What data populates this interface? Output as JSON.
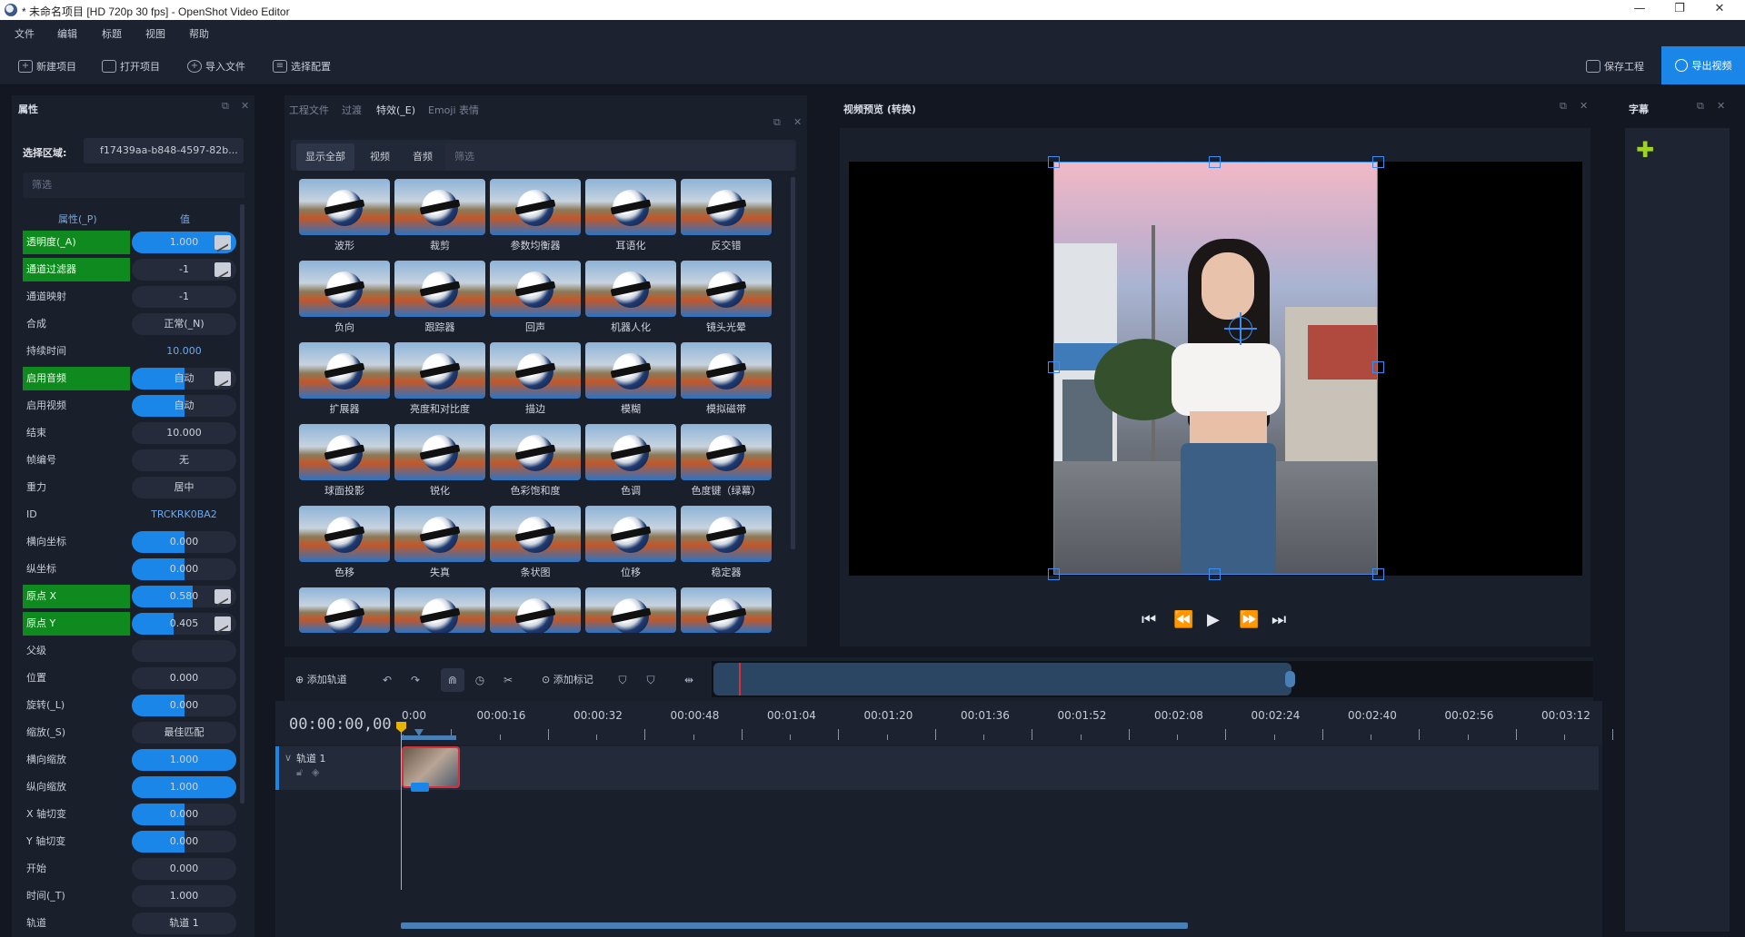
{
  "window": {
    "title": "* 未命名项目 [HD 720p 30 fps] - OpenShot Video Editor",
    "min": "—",
    "max": "❐",
    "close": "✕"
  },
  "menu": [
    "文件",
    "编辑",
    "标题",
    "视图",
    "帮助"
  ],
  "toolbar": {
    "new_project": "新建项目",
    "open_project": "打开项目",
    "import_files": "导入文件",
    "profile": "选择配置",
    "save": "保存工程",
    "export": "导出视频"
  },
  "properties": {
    "title": "属性",
    "selection_label": "选择区域:",
    "selection_value": "f17439aa-b848-4597-82b...",
    "filter_placeholder": "筛选",
    "col_property": "属性(_P)",
    "col_value": "值",
    "rows": [
      {
        "label": "透明度(_A)",
        "value": "1.000",
        "green": true,
        "fill": 1.0,
        "kf": true
      },
      {
        "label": "通道过滤器",
        "value": "-1",
        "green": true,
        "fill": 0,
        "kf": true
      },
      {
        "label": "通道映射",
        "value": "-1",
        "green": false,
        "fill": 0,
        "kf": false
      },
      {
        "label": "合成",
        "value": "正常(_N)",
        "green": false,
        "fill": 0,
        "kf": false
      },
      {
        "label": "持续时间",
        "value": "10.000",
        "green": false,
        "fill": -1,
        "kf": false
      },
      {
        "label": "启用音频",
        "value": "自动",
        "green": true,
        "fill": 0.5,
        "kf": true
      },
      {
        "label": "启用视频",
        "value": "自动",
        "green": false,
        "fill": 0.5,
        "kf": false
      },
      {
        "label": "结束",
        "value": "10.000",
        "green": false,
        "fill": 0,
        "kf": false
      },
      {
        "label": "帧编号",
        "value": "无",
        "green": false,
        "fill": 0,
        "kf": false
      },
      {
        "label": "重力",
        "value": "居中",
        "green": false,
        "fill": 0,
        "kf": false
      },
      {
        "label": "ID",
        "value": "TRCKRK0BA2",
        "green": false,
        "fill": -1,
        "kf": false
      },
      {
        "label": "横向坐标",
        "value": "0.000",
        "green": false,
        "fill": 0.5,
        "kf": false
      },
      {
        "label": "纵坐标",
        "value": "0.000",
        "green": false,
        "fill": 0.5,
        "kf": false
      },
      {
        "label": "原点 X",
        "value": "0.580",
        "green": true,
        "fill": 0.58,
        "kf": true
      },
      {
        "label": "原点 Y",
        "value": "0.405",
        "green": true,
        "fill": 0.4,
        "kf": true
      },
      {
        "label": "父级",
        "value": "",
        "green": false,
        "fill": 0,
        "kf": false
      },
      {
        "label": "位置",
        "value": "0.000",
        "green": false,
        "fill": 0,
        "kf": false
      },
      {
        "label": "旋转(_L)",
        "value": "0.000",
        "green": false,
        "fill": 0.5,
        "kf": false
      },
      {
        "label": "缩放(_S)",
        "value": "最佳匹配",
        "green": false,
        "fill": 0,
        "kf": false
      },
      {
        "label": "横向缩放",
        "value": "1.000",
        "green": false,
        "fill": 1.0,
        "kf": false
      },
      {
        "label": "纵向缩放",
        "value": "1.000",
        "green": false,
        "fill": 1.0,
        "kf": false
      },
      {
        "label": "X 轴切变",
        "value": "0.000",
        "green": false,
        "fill": 0.5,
        "kf": false
      },
      {
        "label": "Y 轴切变",
        "value": "0.000",
        "green": false,
        "fill": 0.5,
        "kf": false
      },
      {
        "label": "开始",
        "value": "0.000",
        "green": false,
        "fill": 0,
        "kf": false
      },
      {
        "label": "时间(_T)",
        "value": "1.000",
        "green": false,
        "fill": 0,
        "kf": false
      },
      {
        "label": "轨道",
        "value": "轨道 1",
        "green": false,
        "fill": 0,
        "kf": false
      }
    ]
  },
  "effects": {
    "tabs": [
      "工程文件",
      "过渡",
      "特效(_E)",
      "Emoji 表情"
    ],
    "filters": [
      "显示全部",
      "视频",
      "音频",
      "筛选"
    ],
    "items": [
      "波形",
      "裁剪",
      "参数均衡器",
      "耳语化",
      "反交错",
      "负向",
      "跟踪器",
      "回声",
      "机器人化",
      "镜头光晕",
      "扩展器",
      "亮度和对比度",
      "描边",
      "模糊",
      "模拟磁带",
      "球面投影",
      "锐化",
      "色彩饱和度",
      "色调",
      "色度键（绿幕）",
      "色移",
      "失真",
      "条状图",
      "位移",
      "稳定器",
      "",
      "",
      "",
      "",
      ""
    ]
  },
  "preview": {
    "title": "视频预览 (转换)"
  },
  "subtitles": {
    "title": "字幕"
  },
  "timeline": {
    "add_track": "添加轨道",
    "add_marker": "添加标记",
    "time": "00:00:00,00",
    "ticks": [
      "0:00",
      "00:00:16",
      "00:00:32",
      "00:00:48",
      "00:01:04",
      "00:01:20",
      "00:01:36",
      "00:01:52",
      "00:02:08",
      "00:02:24",
      "00:02:40",
      "00:02:56",
      "00:03:12"
    ],
    "track_name": "轨道 1"
  },
  "colors": {
    "accent": "#1a87e8",
    "keyframe_green": "#0f8a1f",
    "panel": "#1a1f2c",
    "playhead": "#e8b400"
  }
}
